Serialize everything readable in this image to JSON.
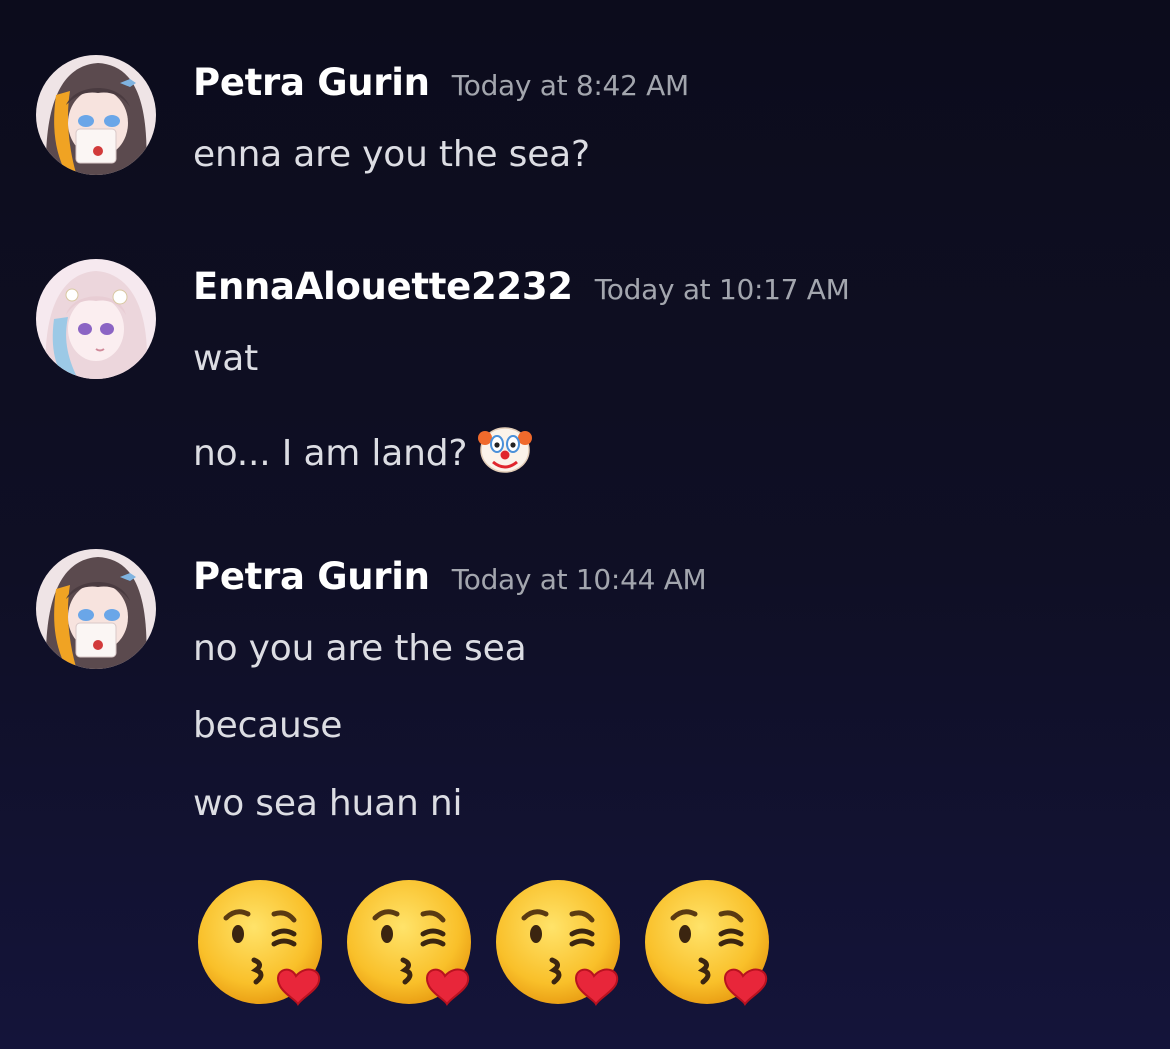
{
  "messages": [
    {
      "author": "Petra Gurin",
      "timestamp": "Today at 8:42 AM",
      "lines": [
        "enna are you the sea?"
      ]
    },
    {
      "author": "EnnaAlouette2232",
      "timestamp": "Today at 10:17 AM",
      "lines": [
        "wat",
        "no... I am land?"
      ],
      "emoji": "clown-face"
    },
    {
      "author": "Petra Gurin",
      "timestamp": "Today at 10:44 AM",
      "lines": [
        "no you are the sea",
        "because",
        "wo sea huan ni"
      ],
      "emoji_line": [
        "face-blowing-a-kiss",
        "face-blowing-a-kiss",
        "face-blowing-a-kiss",
        "face-blowing-a-kiss"
      ]
    }
  ],
  "colors": {
    "background_top": "#0c0c1c",
    "background_bottom": "#14143a",
    "username": "#ffffff",
    "timestamp": "#a3a6ae",
    "message_text": "#dcdde3"
  }
}
